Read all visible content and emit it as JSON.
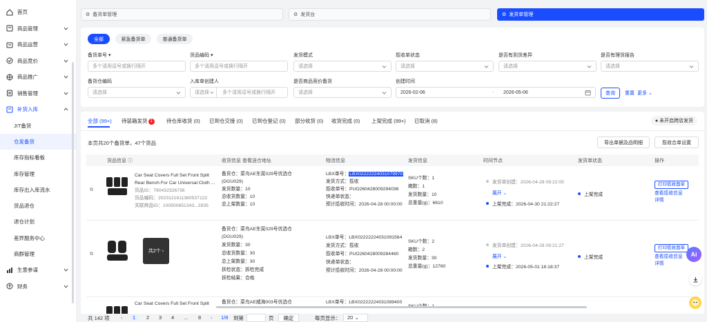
{
  "sidebar": {
    "items": [
      {
        "label": "首页",
        "icon": "home-icon"
      },
      {
        "label": "商品管理",
        "icon": "box-icon"
      },
      {
        "label": "商品运营",
        "icon": "store-icon"
      },
      {
        "label": "商品竞价",
        "icon": "bid-icon"
      },
      {
        "label": "商品推广",
        "icon": "globe-icon"
      },
      {
        "label": "销售管理",
        "icon": "doc-icon"
      },
      {
        "label": "补货入库",
        "icon": "inbound-icon"
      }
    ],
    "sub_items": [
      "JIT备货",
      "仓发备货",
      "库存指标看板",
      "库存管理",
      "库存出入库流水",
      "货品退仓",
      "退仓计划",
      "差异服务中心",
      "商群管理"
    ],
    "bottom_items": [
      {
        "label": "生意参谋",
        "icon": "chart-icon"
      },
      {
        "label": "财务",
        "icon": "finance-icon"
      }
    ]
  },
  "tabs": [
    {
      "label": "备货单管理"
    },
    {
      "label": "发货台"
    },
    {
      "label": "发货单管理"
    }
  ],
  "filter": {
    "chips": [
      "全部",
      "紧急备货单",
      "普通备货单"
    ],
    "row1": [
      {
        "label": "备货单号",
        "pre": "",
        "placeholder": "多个请用逗号或换行隔开"
      },
      {
        "label": "货品编码",
        "pre": "",
        "placeholder": "多个请用逗号或换行隔开"
      },
      {
        "label": "发货模式",
        "placeholder": "请选择"
      },
      {
        "label": "揽收单状态",
        "placeholder": "请选择"
      },
      {
        "label": "是否有到货差异",
        "placeholder": "请选择"
      },
      {
        "label": "是否有理货报告",
        "placeholder": "请选择"
      }
    ],
    "row2": [
      {
        "label": "备货仓编码",
        "placeholder": "请选择"
      },
      {
        "label": "入库单创建人",
        "pre": "请选择",
        "placeholder": "多个请用逗号或换行隔开"
      },
      {
        "label": "是否商品竞价备货",
        "placeholder": "请选择"
      },
      {
        "label": "创建时间"
      }
    ],
    "date_from": "2026-02-06",
    "date_to": "2026-05-06",
    "date_sep": "-",
    "search_label": "查询",
    "reset_label": "重置",
    "more_label": "更多"
  },
  "status_tabs": [
    "全部 (99+)",
    "待装箱发货",
    "待仓库收货 (0)",
    "已到仓交接 (0)",
    "已到仓登记 (0)",
    "部分收货 (0)",
    "收货完成 (0)",
    "上架完成 (99+)",
    "已取消 (8)"
  ],
  "status_badge_count": "1",
  "iso_status": "未开启跨店发货",
  "summary": "本页共20个备货单，47个货品",
  "actions": {
    "export": "导出单据及品明细",
    "receipt_settings": "揽收合单设置"
  },
  "columns": [
    "货品信息",
    "收货信息 查看送仓地址",
    "物流信息",
    "发货信息",
    "时间节点",
    "发货单状态",
    "操作"
  ],
  "rows": [
    {
      "product_title_1": "Car Seat Covers Full Set Front Split",
      "product_title_2": "Rear Bench For Car Universal Cloth ...",
      "goods_id": "货品ID：760432326736",
      "goods_code": "货品编码：2023121811380537122",
      "related_id": "关联商品ID：100500651343...2835",
      "warehouse": "备货仓：菜鸟AE东莞029号优选仓",
      "warehouse_2": "(DGU029)",
      "ship_qty": "发货数量：10",
      "recv_qty": "总收货数量：10",
      "shelf_qty": "总上架数量：10",
      "lbx_label": "LBX单号：",
      "lbx": "LBX02222224031079970",
      "ship_mode": "发货方式：揽收",
      "pickup_no": "揽收单号：PUO260428009294036",
      "express": "快递单状态：",
      "est_time": "预计揽收时间：2026-04-28 00:00:00",
      "sku_count": "SKU个数：1",
      "box_count": "箱数：1",
      "ship_count": "发货数量：10",
      "weight": "总重量(g)：6610",
      "t_created": "发货单创建：2026-04-28 09:22:05",
      "expand": "展开",
      "t_shelved": "上架完成：2026-04-30 21:22:27",
      "status": "上架完成",
      "op_print": "打印揽收面单",
      "op_view": "查看揽收信息",
      "op_detail": "详情"
    },
    {
      "more_images": "共2个",
      "warehouse": "备货仓：菜鸟AE东莞029号优选仓",
      "warehouse_2": "(DGU029)",
      "ship_qty": "发货数量：30",
      "recv_qty": "总收货数量：30",
      "shelf_qty": "总上架数量：30",
      "tally": "拆检状态：拆检完成",
      "tally_result": "拆检结果：合格",
      "lbx": "LBX单号：LBX02222224031091564",
      "ship_mode": "发货方式：揽收",
      "pickup_no": "揽收单号：PUO260428009284460",
      "express": "快递单状态：",
      "est_time": "预计揽收时间：2026-04-28 00:00:00",
      "sku_count": "SKU个数：2",
      "box_count": "箱数：2",
      "ship_count": "发货数量：30",
      "weight": "总重量(g)：12760",
      "t_created": "发货单创建：2026-04-28 09:21:27",
      "expand": "展开",
      "t_shelved": "上架完成：2026-05-01 18:18:37",
      "status": "上架完成",
      "op_print": "打印揽收面单",
      "op_view": "查看揽收信息",
      "op_detail": "详情"
    },
    {
      "product_title_1": "Car Seat Covers Full Set Front Split",
      "warehouse": "备货仓：菜鸟AE威海003号优选仓",
      "lbx": "LBX单号：LBX02222224031089400",
      "sku_count": "SKU个数：1"
    }
  ],
  "pager": {
    "total": "共 142 项",
    "pages": [
      "1",
      "2",
      "3",
      "4",
      "...",
      "8"
    ],
    "current": "1/8",
    "goto": "到第",
    "page_unit": "页",
    "confirm": "确定",
    "per_page_label": "每页显示：",
    "per_page": "20"
  },
  "float_ai": "Ai"
}
